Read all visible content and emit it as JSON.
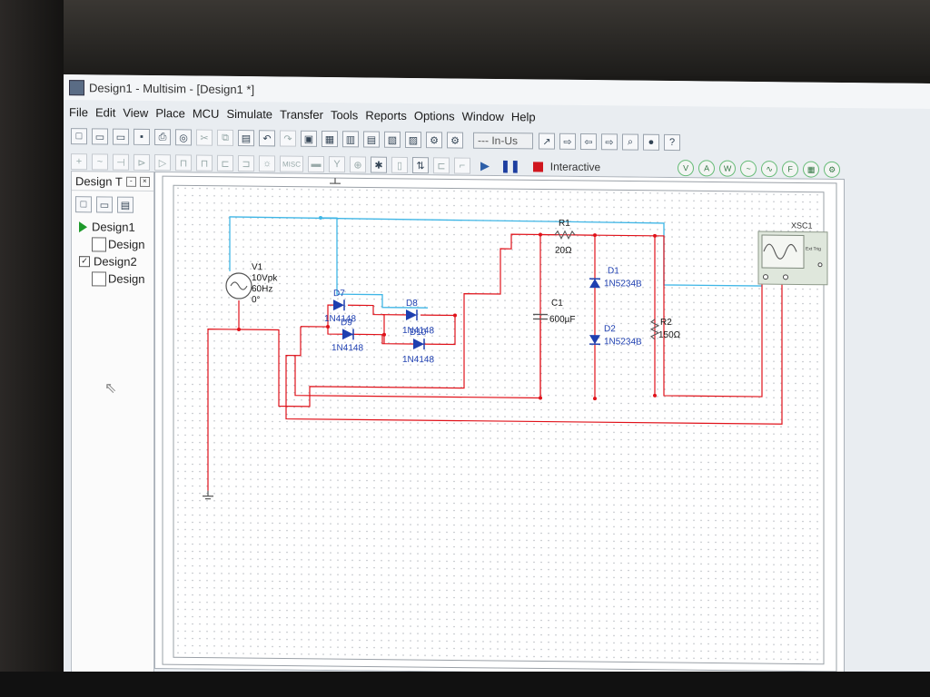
{
  "window": {
    "title": "Design1 - Multisim - [Design1 *]"
  },
  "menu": [
    "File",
    "Edit",
    "View",
    "Place",
    "MCU",
    "Simulate",
    "Transfer",
    "Tools",
    "Reports",
    "Options",
    "Window",
    "Help"
  ],
  "toolbar": {
    "in_use_label": "--- In-Us",
    "sim_mode": "Interactive",
    "misc_label": "MISC"
  },
  "design_toolbox": {
    "title": "Design T",
    "items": [
      {
        "label": "Design1",
        "icon": "play-arrow-icon"
      },
      {
        "label": "Design",
        "icon": "schematic-sheet-icon"
      },
      {
        "label": "Design2",
        "icon": "checkbox-icon"
      },
      {
        "label": "Design",
        "icon": "schematic-sheet-icon"
      }
    ]
  },
  "schematic": {
    "source": {
      "name": "V1",
      "amplitude": "10Vpk",
      "freq": "60Hz",
      "phase": "0°"
    },
    "diodes": [
      {
        "ref": "D7",
        "part": "1N4148"
      },
      {
        "ref": "D8",
        "part": "1N4148"
      },
      {
        "ref": "D9",
        "part": "1N4148"
      },
      {
        "ref": "D10",
        "part": "1N4148"
      },
      {
        "ref": "D1",
        "part": "1N5234B"
      },
      {
        "ref": "D2",
        "part": "1N5234B"
      }
    ],
    "r1": {
      "ref": "R1",
      "value": "20Ω"
    },
    "r2": {
      "ref": "R2",
      "value": "150Ω"
    },
    "c1": {
      "ref": "C1",
      "value": "600µF"
    },
    "scope": {
      "ref": "XSC1",
      "trig": "Ext Trig"
    },
    "colors": {
      "wire": "#e0121a",
      "probe": "#3fb6e6",
      "part": "#1e3fb0",
      "grid": "#c9ccd1"
    }
  }
}
